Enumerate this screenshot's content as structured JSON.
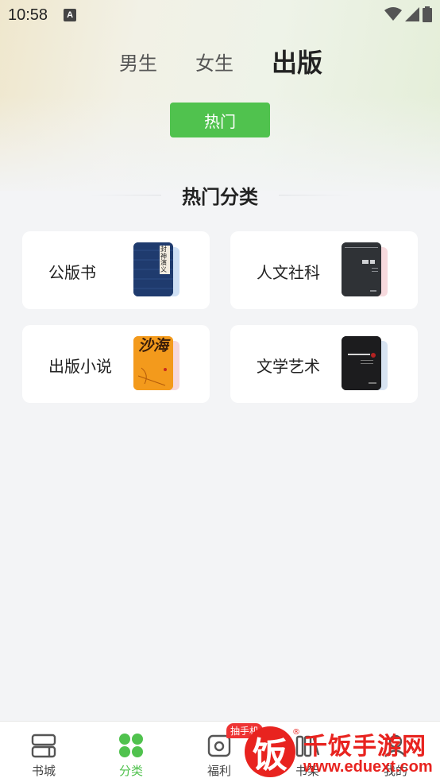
{
  "status_bar": {
    "time": "10:58",
    "notification_icon": "A"
  },
  "tabs": [
    {
      "label": "男生",
      "active": false
    },
    {
      "label": "女生",
      "active": false
    },
    {
      "label": "出版",
      "active": true
    }
  ],
  "filter_button": {
    "label": "热门"
  },
  "section": {
    "title": "热门分类"
  },
  "categories": [
    {
      "label": "公版书",
      "cover_text": "封神演义",
      "cover_color": "#1f3b6e"
    },
    {
      "label": "人文社科",
      "cover_text": "",
      "cover_color": "#2f3236"
    },
    {
      "label": "出版小说",
      "cover_text": "沙海",
      "cover_color": "#f39a1c"
    },
    {
      "label": "文学艺术",
      "cover_text": "",
      "cover_color": "#1c1c1e"
    }
  ],
  "bottom_nav": [
    {
      "label": "书城",
      "icon": "bookstore-icon",
      "active": false
    },
    {
      "label": "分类",
      "icon": "category-icon",
      "active": true
    },
    {
      "label": "福利",
      "icon": "welfare-icon",
      "active": false
    },
    {
      "label": "书架",
      "icon": "bookshelf-icon",
      "active": false
    },
    {
      "label": "我的",
      "icon": "profile-icon",
      "active": false
    }
  ],
  "badge": {
    "label": "抽手机"
  },
  "watermark": {
    "logo": "饭",
    "name": "千饭手游网",
    "url": "www.eduext.com"
  },
  "colors": {
    "accent": "#50c24e",
    "background": "#f3f4f6",
    "badge": "#e33333"
  }
}
